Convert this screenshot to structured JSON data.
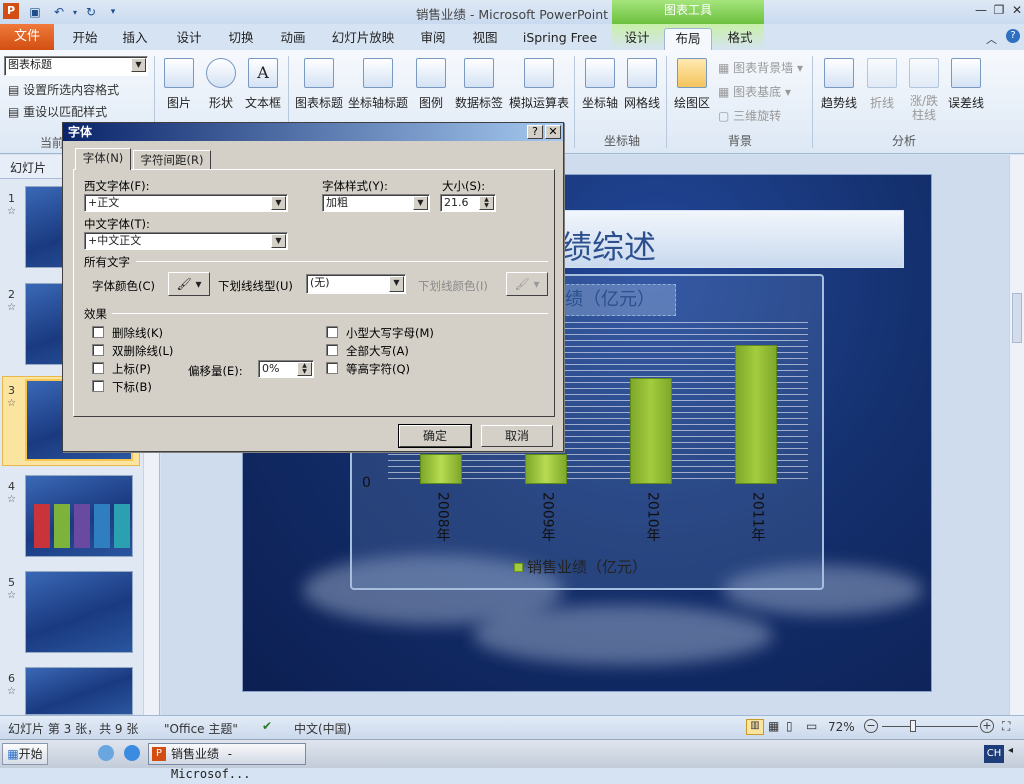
{
  "window": {
    "title": "销售业绩 - Microsoft PowerPoint",
    "context_tab_group": "图表工具"
  },
  "tabs": {
    "file": "文件",
    "items": [
      "开始",
      "插入",
      "设计",
      "切换",
      "动画",
      "幻灯片放映",
      "审阅",
      "视图",
      "iSpring Free",
      "设计",
      "布局",
      "格式"
    ],
    "selected": "布局"
  },
  "ribbon": {
    "selection_dropdown": "图表标题",
    "format_selection": "设置所选内容格式",
    "reset_style": "重设以匹配样式",
    "current_selection_group": "当前",
    "insert_buttons": [
      "图片",
      "形状",
      "文本框"
    ],
    "label_buttons": [
      "图表标题",
      "坐标轴标题",
      "图例",
      "数据标签",
      "模拟运算表"
    ],
    "axes_buttons": [
      "坐标轴",
      "网格线"
    ],
    "axes_group": "坐标轴",
    "background_buttons": {
      "plot_area": "绘图区",
      "chart_wall": "图表背景墙",
      "chart_floor": "图表基底",
      "rotation": "三维旋转"
    },
    "background_group": "背景",
    "analysis_buttons": {
      "trendline": "趋势线",
      "lines": "折线",
      "updown_line1": "涨/跌",
      "updown_line2": "柱线",
      "error_bars": "误差线"
    },
    "analysis_group": "分析"
  },
  "left_pane": {
    "tab": "幻灯片",
    "slide_numbers": [
      "1",
      "2",
      "3",
      "4",
      "5",
      "6"
    ],
    "selected": "3"
  },
  "slide": {
    "title": "绩综述",
    "chart_title": "绩（亿元）"
  },
  "chart_data": {
    "type": "bar",
    "categories": [
      "2008年",
      "2009年",
      "2010年",
      "2011年"
    ],
    "series": [
      {
        "name": "销售业绩（亿元）",
        "values": [
          null,
          null,
          13.1,
          17.2
        ]
      }
    ],
    "ylim": [
      0,
      20
    ],
    "y_tick_labels": [
      "0"
    ],
    "legend": "bottom",
    "bar_color": "#a4cc3e"
  },
  "dialog": {
    "title": "字体",
    "help": "?",
    "close": "✕",
    "tabs": [
      "字体(N)",
      "字符间距(R)"
    ],
    "western_font_label": "西文字体(F):",
    "western_font_value": "+正文",
    "font_style_label": "字体样式(Y):",
    "font_style_value": "加粗",
    "size_label": "大小(S):",
    "size_value": "21.6",
    "asian_font_label": "中文字体(T):",
    "asian_font_value": "+中文正文",
    "all_text_label": "所有文字",
    "font_color_label": "字体颜色(C)",
    "underline_style_label": "下划线线型(U)",
    "underline_style_value": "(无)",
    "underline_color_label": "下划线颜色(I)",
    "effects_label": "效果",
    "effects": [
      "删除线(K)",
      "双删除线(L)",
      "上标(P)",
      "下标(B)",
      "小型大写字母(M)",
      "全部大写(A)",
      "等高字符(Q)"
    ],
    "offset_label": "偏移量(E):",
    "offset_value": "0%",
    "ok": "确定",
    "cancel": "取消"
  },
  "statusbar": {
    "slide_info": "幻灯片 第 3 张，共 9 张",
    "theme": "\"Office 主题\"",
    "language": "中文(中国)",
    "zoom": "72%"
  },
  "taskbar": {
    "start": "开始",
    "app": "销售业绩 - Microsof...",
    "ime": "CH"
  }
}
